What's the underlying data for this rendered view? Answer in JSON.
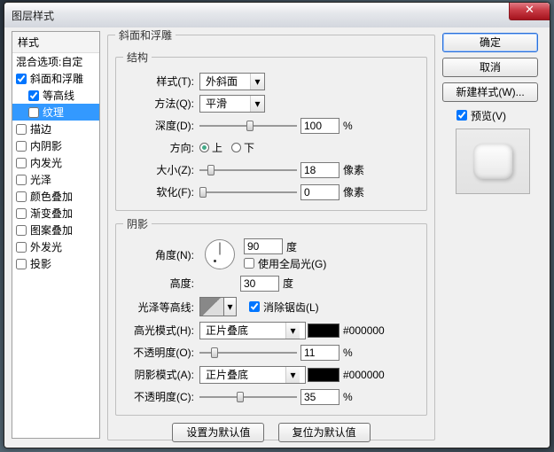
{
  "window": {
    "title": "图层样式"
  },
  "styles_panel": {
    "header": "样式",
    "blend_row": "混合选项:自定",
    "items": [
      {
        "label": "斜面和浮雕",
        "checked": true,
        "selected": false,
        "sub": false
      },
      {
        "label": "等高线",
        "checked": true,
        "selected": false,
        "sub": true
      },
      {
        "label": "纹理",
        "checked": false,
        "selected": true,
        "sub": true
      },
      {
        "label": "描边",
        "checked": false,
        "selected": false,
        "sub": false
      },
      {
        "label": "内阴影",
        "checked": false,
        "selected": false,
        "sub": false
      },
      {
        "label": "内发光",
        "checked": false,
        "selected": false,
        "sub": false
      },
      {
        "label": "光泽",
        "checked": false,
        "selected": false,
        "sub": false
      },
      {
        "label": "颜色叠加",
        "checked": false,
        "selected": false,
        "sub": false
      },
      {
        "label": "渐变叠加",
        "checked": false,
        "selected": false,
        "sub": false
      },
      {
        "label": "图案叠加",
        "checked": false,
        "selected": false,
        "sub": false
      },
      {
        "label": "外发光",
        "checked": false,
        "selected": false,
        "sub": false
      },
      {
        "label": "投影",
        "checked": false,
        "selected": false,
        "sub": false
      }
    ]
  },
  "main": {
    "legend": "斜面和浮雕",
    "structure": {
      "legend": "结构",
      "style": {
        "label": "样式(T):",
        "value": "外斜面"
      },
      "method": {
        "label": "方法(Q):",
        "value": "平滑"
      },
      "depth": {
        "label": "深度(D):",
        "value": "100",
        "unit": "%",
        "pos": 48
      },
      "direction": {
        "label": "方向:",
        "up": "上",
        "down": "下",
        "selected": "up"
      },
      "size": {
        "label": "大小(Z):",
        "value": "18",
        "unit": "像素",
        "pos": 8
      },
      "soften": {
        "label": "软化(F):",
        "value": "0",
        "unit": "像素",
        "pos": 0
      }
    },
    "shading": {
      "legend": "阴影",
      "angle": {
        "label": "角度(N):",
        "value": "90",
        "unit": "度"
      },
      "global": {
        "label": "使用全局光(G)",
        "checked": false
      },
      "altitude": {
        "label": "高度:",
        "value": "30",
        "unit": "度"
      },
      "gloss": {
        "label": "光泽等高线:",
        "antialias_label": "消除锯齿(L)",
        "antialias_checked": true
      },
      "highlight": {
        "label": "高光模式(H):",
        "mode": "正片叠底",
        "hex": "#000000"
      },
      "h_opacity": {
        "label": "不透明度(O):",
        "value": "11",
        "unit": "%",
        "pos": 12
      },
      "shadow": {
        "label": "阴影模式(A):",
        "mode": "正片叠底",
        "hex": "#000000"
      },
      "s_opacity": {
        "label": "不透明度(C):",
        "value": "35",
        "unit": "%",
        "pos": 38
      }
    },
    "footer": {
      "set_default": "设置为默认值",
      "reset_default": "复位为默认值"
    }
  },
  "right": {
    "ok": "确定",
    "cancel": "取消",
    "new_style": "新建样式(W)...",
    "preview_label": "预览(V)",
    "preview_checked": true
  }
}
